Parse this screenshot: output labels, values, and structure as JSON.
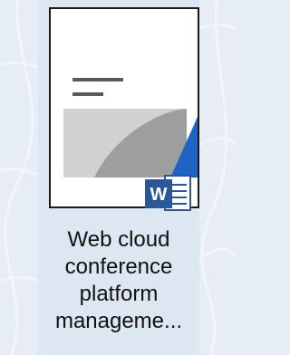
{
  "file": {
    "name_line1": "Web cloud",
    "name_line2": "conference",
    "name_line3": "platform",
    "name_line4": "manageme...",
    "type_badge_letter": "W",
    "app_icon": "word-document-icon"
  },
  "colors": {
    "background": "#e6edf4",
    "tile": "#dce7f2",
    "word_blue": "#2b579a",
    "accent_blue": "#1f63c4",
    "gray_band": "#cfd1d3",
    "gray_dark": "#9d9ea0"
  }
}
